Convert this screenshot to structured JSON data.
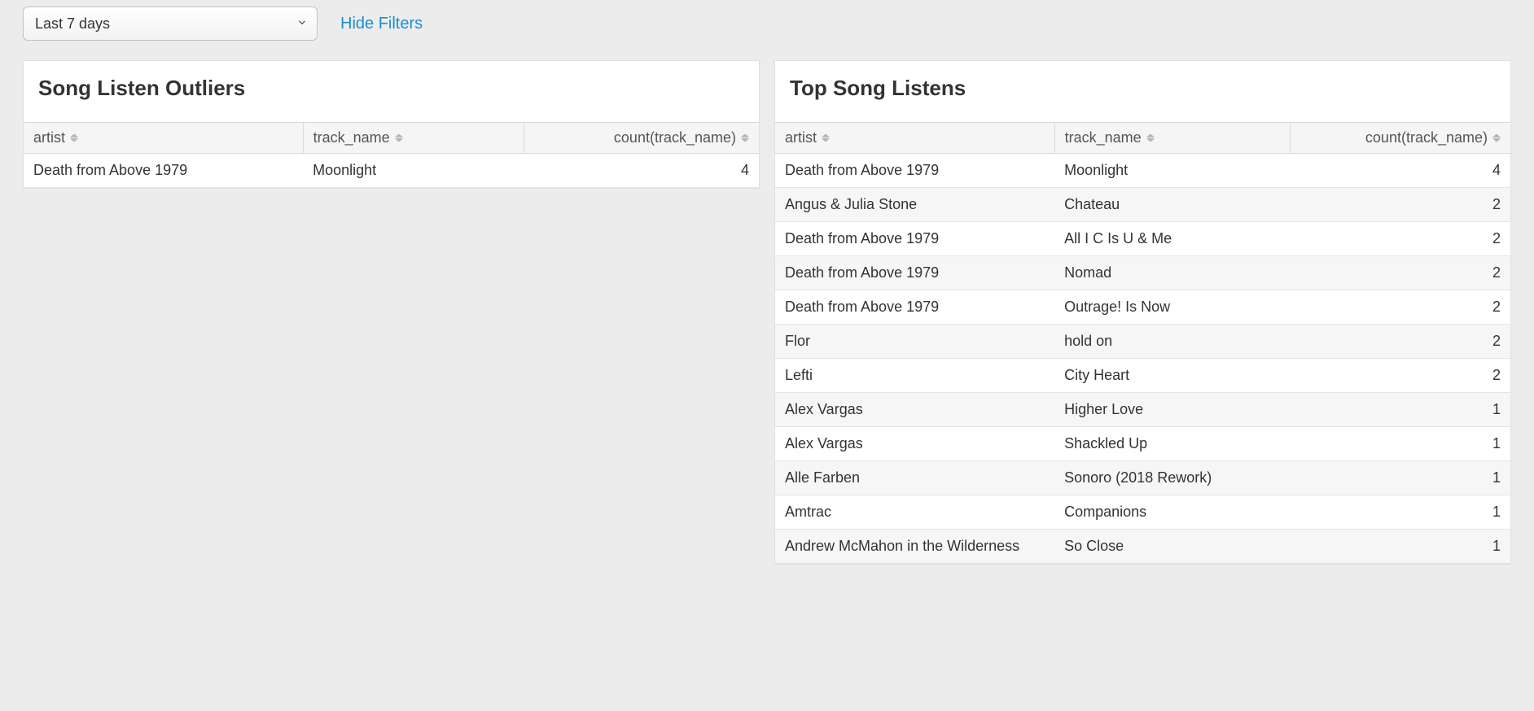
{
  "filters": {
    "time_range_selected": "Last 7 days",
    "hide_filters_label": "Hide Filters"
  },
  "panels": {
    "outliers": {
      "title": "Song Listen Outliers",
      "columns": [
        "artist",
        "track_name",
        "count(track_name)"
      ],
      "rows": [
        {
          "artist": "Death from Above 1979",
          "track_name": "Moonlight",
          "count": "4"
        }
      ]
    },
    "top": {
      "title": "Top Song Listens",
      "columns": [
        "artist",
        "track_name",
        "count(track_name)"
      ],
      "rows": [
        {
          "artist": "Death from Above 1979",
          "track_name": "Moonlight",
          "count": "4"
        },
        {
          "artist": "Angus & Julia Stone",
          "track_name": "Chateau",
          "count": "2"
        },
        {
          "artist": "Death from Above 1979",
          "track_name": "All I C Is U & Me",
          "count": "2"
        },
        {
          "artist": "Death from Above 1979",
          "track_name": "Nomad",
          "count": "2"
        },
        {
          "artist": "Death from Above 1979",
          "track_name": "Outrage! Is Now",
          "count": "2"
        },
        {
          "artist": "Flor",
          "track_name": "hold on",
          "count": "2"
        },
        {
          "artist": "Lefti",
          "track_name": "City Heart",
          "count": "2"
        },
        {
          "artist": "Alex Vargas",
          "track_name": "Higher Love",
          "count": "1"
        },
        {
          "artist": "Alex Vargas",
          "track_name": "Shackled Up",
          "count": "1"
        },
        {
          "artist": "Alle Farben",
          "track_name": "Sonoro (2018 Rework)",
          "count": "1"
        },
        {
          "artist": "Amtrac",
          "track_name": "Companions",
          "count": "1"
        },
        {
          "artist": "Andrew McMahon in the Wilderness",
          "track_name": "So Close",
          "count": "1"
        }
      ]
    }
  }
}
